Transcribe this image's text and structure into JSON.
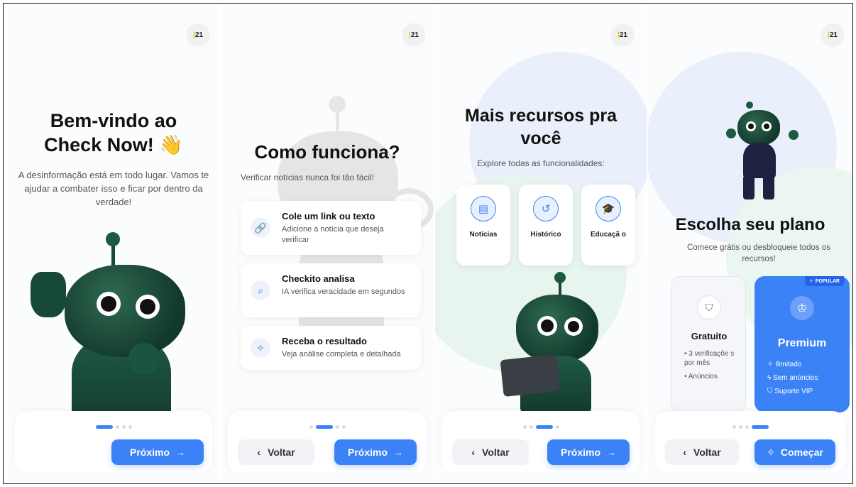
{
  "logo_text": "21",
  "screen1": {
    "title_line1": "Bem-vindo ao",
    "title_line2": "Check Now! 👋",
    "subtitle": "A desinformação está em todo lugar. Vamos te ajudar a combater isso e ficar por dentro da verdade!",
    "next_label": "Próximo"
  },
  "screen2": {
    "title": "Como funciona?",
    "subtitle": "Verificar notícias nunca foi tão fácil!",
    "cards": [
      {
        "title": "Cole um link ou texto",
        "desc": "Adicione a notícia que deseja verificar",
        "icon": "link-icon"
      },
      {
        "title": "Checkito analisa",
        "desc": "IA verifica veracidade em segundos",
        "icon": "search-icon"
      },
      {
        "title": "Receba o resultado",
        "desc": "Veja análise completa e detalhada",
        "icon": "sparkles-icon"
      }
    ],
    "back_label": "Voltar",
    "next_label": "Próximo"
  },
  "screen3": {
    "title_line1": "Mais recursos pra",
    "title_line2": "você",
    "subtitle": "Explore todas as funcionalidades:",
    "features": [
      {
        "label": "Notícias",
        "icon": "newspaper-icon"
      },
      {
        "label": "Histórico",
        "icon": "history-icon"
      },
      {
        "label": "Educaçã o",
        "icon": "graduation-cap-icon"
      }
    ],
    "back_label": "Voltar",
    "next_label": "Próximo"
  },
  "screen4": {
    "title": "Escolha seu plano",
    "subtitle": "Comece grátis ou desbloqueie todos os recursos!",
    "free": {
      "name": "Gratuito",
      "items": [
        "3 verificaçõe s por mês",
        "Anúncios"
      ]
    },
    "premium": {
      "badge": "POPULAR",
      "name": "Premium",
      "items": [
        "Ilimitado",
        "Sem anúncios",
        "Suporte VIP"
      ]
    },
    "back_label": "Voltar",
    "start_label": "Começar"
  },
  "colors": {
    "accent": "#3b82f6",
    "robot": "#1a4d3a"
  }
}
